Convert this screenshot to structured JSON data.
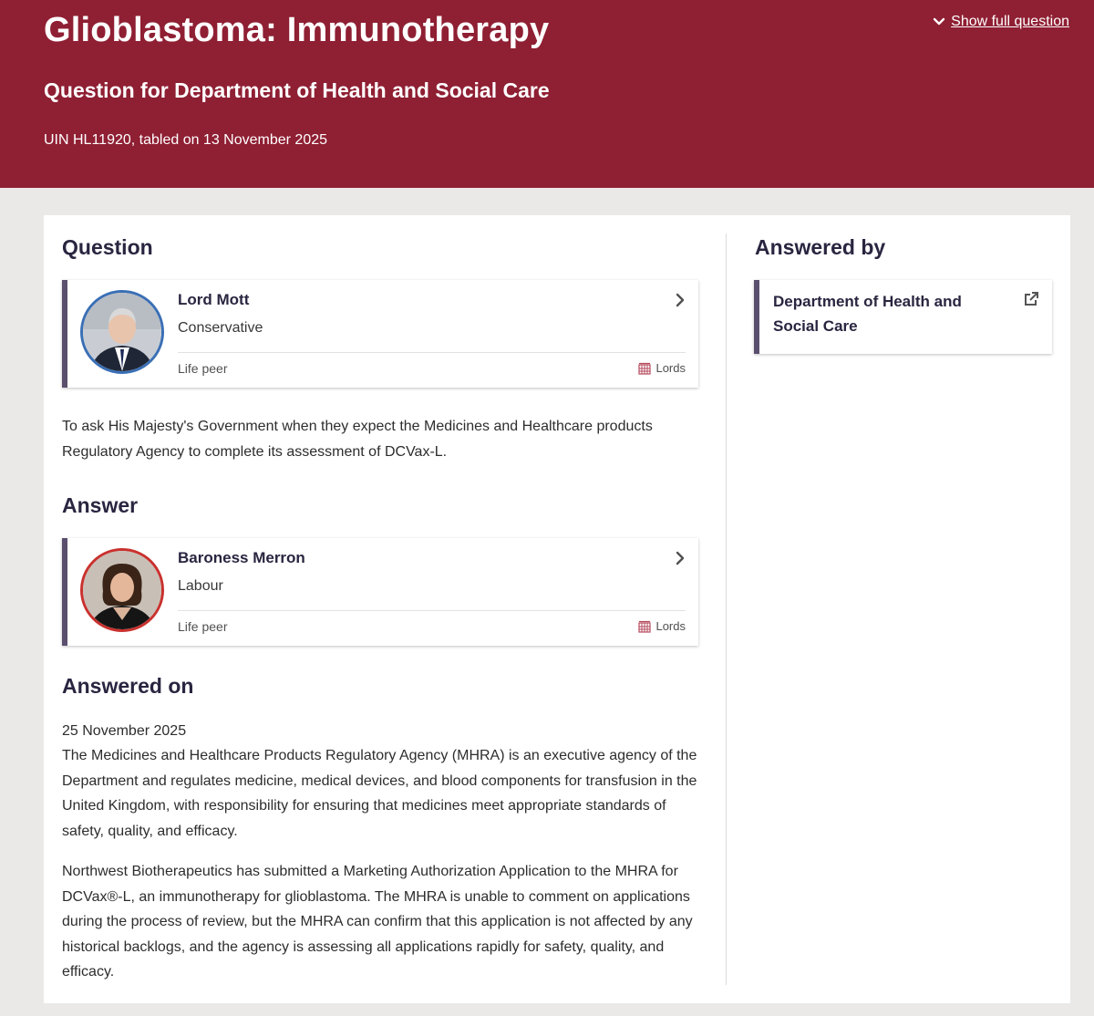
{
  "header": {
    "title": "Glioblastoma: Immunotherapy",
    "subtitle": "Question for Department of Health and Social Care",
    "meta": "UIN HL11920, tabled on 13 November 2025",
    "show_full_label": "Show full question",
    "background_color": "#8f1f33"
  },
  "question": {
    "heading": "Question",
    "member": {
      "name": "Lord Mott",
      "party": "Conservative",
      "party_color": "#3a6fb5",
      "role": "Life peer",
      "house": "Lords"
    },
    "text": "To ask His Majesty's Government when they expect the Medicines and Healthcare products Regulatory Agency to complete its assessment of DCVax-L."
  },
  "answer": {
    "heading": "Answer",
    "member": {
      "name": "Baroness Merron",
      "party": "Labour",
      "party_color": "#c9312e",
      "role": "Life peer",
      "house": "Lords"
    }
  },
  "answered_on": {
    "heading": "Answered on",
    "date": "25 November 2025",
    "paragraphs": [
      "The Medicines and Healthcare Products Regulatory Agency (MHRA) is an executive agency of the Department and regulates medicine, medical devices, and blood components for transfusion in the United Kingdom, with responsibility for ensuring that medicines meet appropriate standards of safety, quality, and efficacy.",
      "Northwest Biotherapeutics has submitted a Marketing Authorization Application to the MHRA for DCVax®-L, an immunotherapy for glioblastoma. The MHRA is unable to comment on applications during the process of review, but the MHRA can confirm that this application is not affected by any historical backlogs, and the agency is assessing all applications rapidly for safety, quality, and efficacy."
    ]
  },
  "answered_by": {
    "heading": "Answered by",
    "department": "Department of Health and Social Care"
  },
  "icons": {
    "show_full": "chevron-down-icon",
    "card_arrow": "chevron-right-icon",
    "house": "portcullis-icon",
    "external": "external-link-icon"
  }
}
